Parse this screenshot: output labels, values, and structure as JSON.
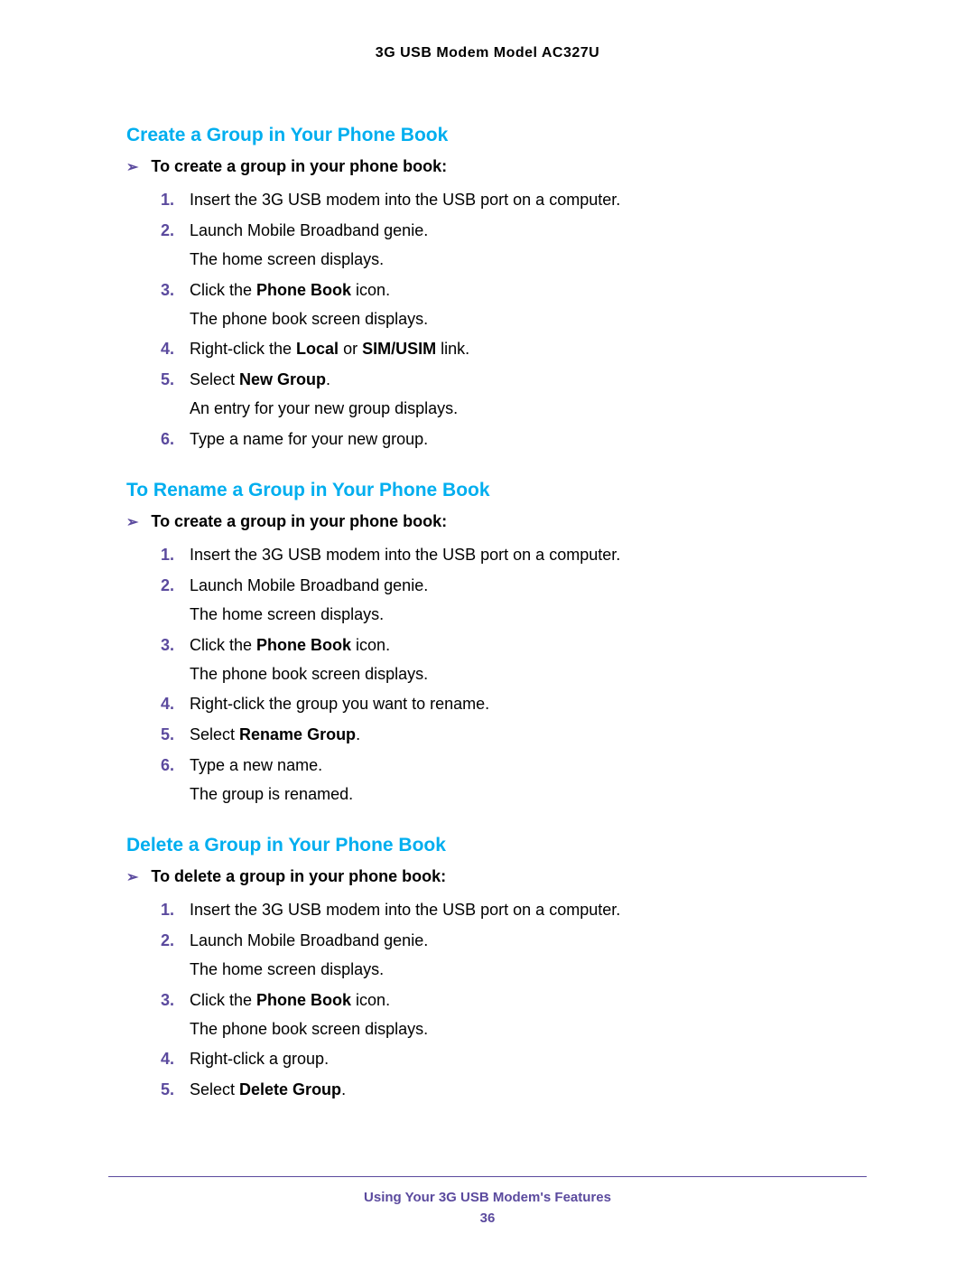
{
  "header": "3G USB Modem Model AC327U",
  "sections": {
    "create": {
      "heading": "Create a Group in Your Phone Book",
      "task": "To create a group in your phone book:",
      "steps": {
        "s1": "Insert the 3G USB modem into the USB port on a computer.",
        "s2a": "Launch Mobile Broadband genie.",
        "s2b": "The home screen displays.",
        "s3a_pre": "Click the ",
        "s3a_bold": "Phone Book",
        "s3a_post": " icon.",
        "s3b": "The phone book screen displays.",
        "s4_pre": "Right-click the ",
        "s4_b1": "Local",
        "s4_mid": " or ",
        "s4_b2": "SIM/USIM",
        "s4_post": " link.",
        "s5_pre": "Select ",
        "s5_bold": "New Group",
        "s5_post": ".",
        "s5b": "An entry for your new group displays.",
        "s6": "Type a name for your new group."
      }
    },
    "rename": {
      "heading": "To Rename a Group in Your Phone Book",
      "task": "To create a group in your phone book:",
      "steps": {
        "s1": "Insert the 3G USB modem into the USB port on a computer.",
        "s2a": "Launch Mobile Broadband genie.",
        "s2b": "The home screen displays.",
        "s3a_pre": "Click the ",
        "s3a_bold": "Phone Book",
        "s3a_post": " icon.",
        "s3b": "The phone book screen displays.",
        "s4": "Right-click the group you want to rename.",
        "s5_pre": "Select ",
        "s5_bold": "Rename Group",
        "s5_post": ".",
        "s6a": "Type a new name.",
        "s6b": "The group is renamed."
      }
    },
    "delete": {
      "heading": "Delete a Group in Your Phone Book",
      "task": "To delete a group in your phone book:",
      "steps": {
        "s1": "Insert the 3G USB modem into the USB port on a computer.",
        "s2a": "Launch Mobile Broadband genie.",
        "s2b": "The home screen displays.",
        "s3a_pre": "Click the ",
        "s3a_bold": "Phone Book",
        "s3a_post": " icon.",
        "s3b": "The phone book screen displays.",
        "s4": "Right-click a group.",
        "s5_pre": "Select ",
        "s5_bold": "Delete Group",
        "s5_post": "."
      }
    }
  },
  "footer": {
    "title": "Using Your 3G USB Modem's Features",
    "page": "36"
  },
  "nums": {
    "n1": "1.",
    "n2": "2.",
    "n3": "3.",
    "n4": "4.",
    "n5": "5.",
    "n6": "6."
  },
  "bullet": "➢"
}
